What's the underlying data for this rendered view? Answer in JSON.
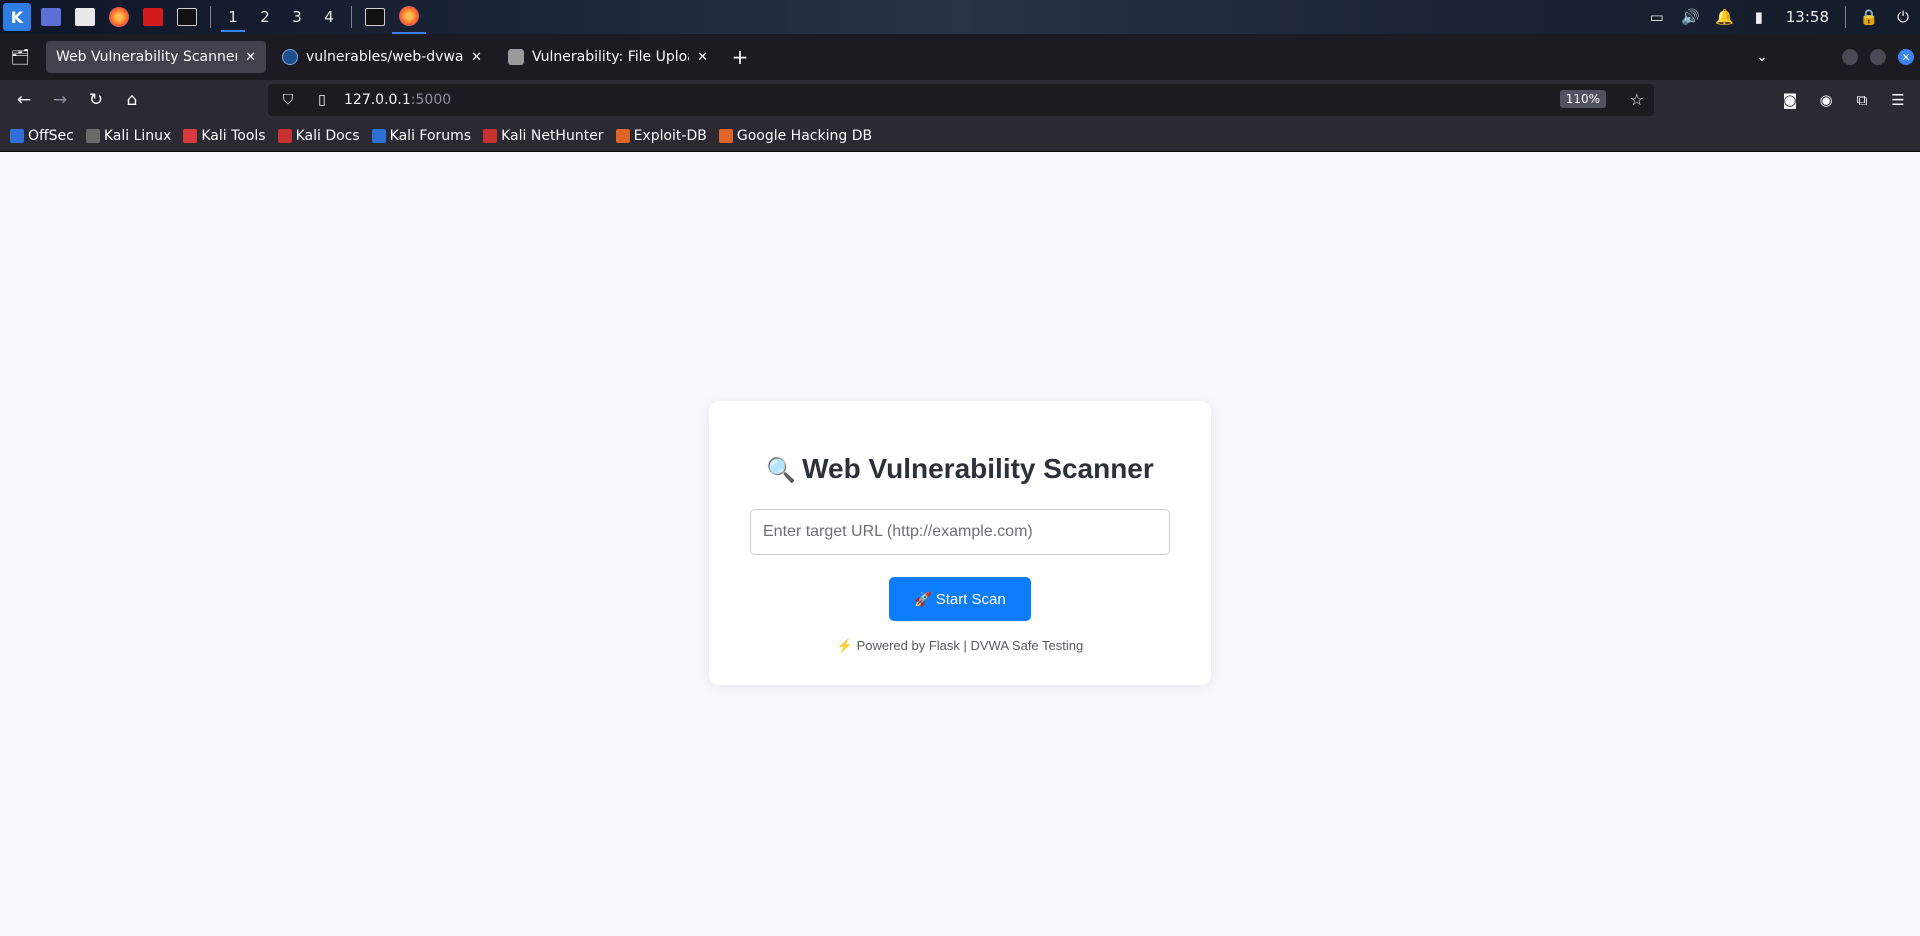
{
  "system_panel": {
    "workspaces": [
      "1",
      "2",
      "3",
      "4"
    ],
    "active_workspace": "1",
    "clock": "13:58",
    "icons": [
      "kali-menu-icon",
      "desktop-icon",
      "files-icon",
      "firefox-icon",
      "red-app-icon",
      "terminal-icon"
    ],
    "tray_icons": [
      "display-icon",
      "volume-icon",
      "bell-icon",
      "battery-icon",
      "lock-icon",
      "power-icon"
    ]
  },
  "tabs": [
    {
      "label": "Web Vulnerability Scanner",
      "active": true,
      "close": "✕"
    },
    {
      "label": "vulnerables/web-dvwa - [",
      "active": false,
      "close": "✕"
    },
    {
      "label": "Vulnerability: File Upload",
      "active": false,
      "close": "✕"
    }
  ],
  "new_tab": "+",
  "url": {
    "host": "127.0.0.1",
    "port": ":5000"
  },
  "zoom": "110%",
  "bookmarks": [
    {
      "label": "OffSec",
      "color": "#2f6fd8"
    },
    {
      "label": "Kali Linux",
      "color": "#3b3b3b"
    },
    {
      "label": "Kali Tools",
      "color": "#d83b3b"
    },
    {
      "label": "Kali Docs",
      "color": "#c8322f"
    },
    {
      "label": "Kali Forums",
      "color": "#2f6fd8"
    },
    {
      "label": "Kali NetHunter",
      "color": "#c8322f"
    },
    {
      "label": "Exploit-DB",
      "color": "#e0652b"
    },
    {
      "label": "Google Hacking DB",
      "color": "#e0652b"
    }
  ],
  "scanner": {
    "title_icon": "🔍",
    "title": "Web Vulnerability Scanner",
    "input_placeholder": "Enter target URL (http://example.com)",
    "input_value": "",
    "button_icon": "🚀",
    "button_label": "Start Scan",
    "footer_icon": "⚡",
    "footer_text": "Powered by Flask | DVWA Safe Testing"
  },
  "colors": {
    "accent": "#0d7dfc",
    "page_bg": "#f8f9fc",
    "browser_chrome": "#2b2a33"
  }
}
